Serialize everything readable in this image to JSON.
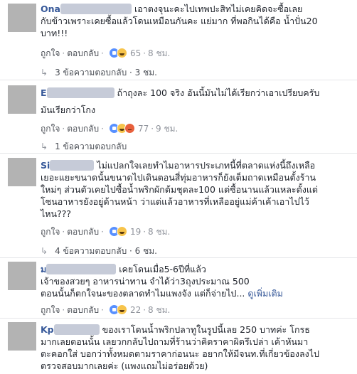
{
  "comments": [
    {
      "name_prefix": "Ona",
      "text_inline": "เอาตงจุนะคะไปเทพปะสิทไม่เคยคิดจะซื้อเลย",
      "text_lines": [
        "กับข้าวเพราะเคยซื้อแล้วโดนเหมือนกันคะ แย่มาก ที่พอกินได้คือ น้ำปั่น20",
        "บาท!!!"
      ],
      "like_label": "ถูกใจ",
      "reply_label": "ตอบกลับ",
      "reaction_count": "65",
      "time": "8 ชม.",
      "replies_label": "3 ข้อความตอบกลับ",
      "replies_time": "3 ชม."
    },
    {
      "name_prefix": "E",
      "text_inline": "ถ้าถุงละ 100 จริง อันนี้มันไม่ได้เรียกว่าเอาเปรียบครับ",
      "text_lines": [
        "มันเรียกว่าโกง"
      ],
      "like_label": "ถูกใจ",
      "reply_label": "ตอบกลับ",
      "reaction_count": "77",
      "time": "9 ชม.",
      "replies_label": "1 ข้อความตอบกลับ"
    },
    {
      "name_prefix": "Si",
      "text_inline": "ไม่แปลกใจเลยทำไมอาหารประเภทนี้ที่ตลาดแห่งนี้ถึงเหลือ",
      "text_lines": [
        "เยอะแยะขนาดนั้นขนาดไปเดินตอนสี่ทุ่มอาหารก็ยังเต็มถาดเหมือนตั้งร้าน",
        "ใหม่ๆ ส่วนตัวเคยไปซื้อน้ำพริกผักต้มชุดละ100 แต่ซื้อนานแล้วแหละตั้งแต่",
        "โซนอาหารยังอยู่ด้านหน้า ว่าแต่แล้วอาหารที่เหลืออยู่แม่ค้าเค้าเอาไปไว้",
        "ไหน???"
      ],
      "like_label": "ถูกใจ",
      "reply_label": "ตอบกลับ",
      "reaction_count": "19",
      "time": "8 ชม.",
      "replies_label": "4 ข้อความตอบกลับ",
      "replies_time": "6 ชม."
    },
    {
      "name_prefix": "ม",
      "text_inline": "เคยโดนเมื่อ5-6ปีที่แล้ว",
      "text_lines": [
        "เจ้าของสวยๆ อาหารน่าทาน จำได้ว่า3ถุงประมาณ 500",
        "ตอนนั้นก็ตกใจนะของตลาดทำไมแพงจัง แต่ก็จ่ายไป..."
      ],
      "more_label": "ดูเพิ่มเติม",
      "like_label": "ถูกใจ",
      "reply_label": "ตอบกลับ",
      "reaction_count": "22",
      "time": "8 ชม."
    },
    {
      "name_prefix": "Kp",
      "text_inline": "ของเราโดนน้ำพริกปลาทูในรูปนี้เลย 250 บาทค่ะ โกรธ",
      "text_lines": [
        "มากเลยตอนนั้น เลยวกกลับไปถามที่ร้านว่าคิดราคาผิดรึเปล่า เค้าหันมา",
        "ตะคอกใส่ บอกว่าทั้งหมดตามราคาก่อนนะ อยากให้มีจนท.ที่เกี่ยวข้องลงไป",
        "ตรวจสอบมากเลยค่ะ (แพงแถมไม่อร่อยด้วย)"
      ]
    }
  ],
  "colors": {
    "name": "#365899",
    "meta": "#90949c",
    "divider": "#e5e6e9"
  }
}
